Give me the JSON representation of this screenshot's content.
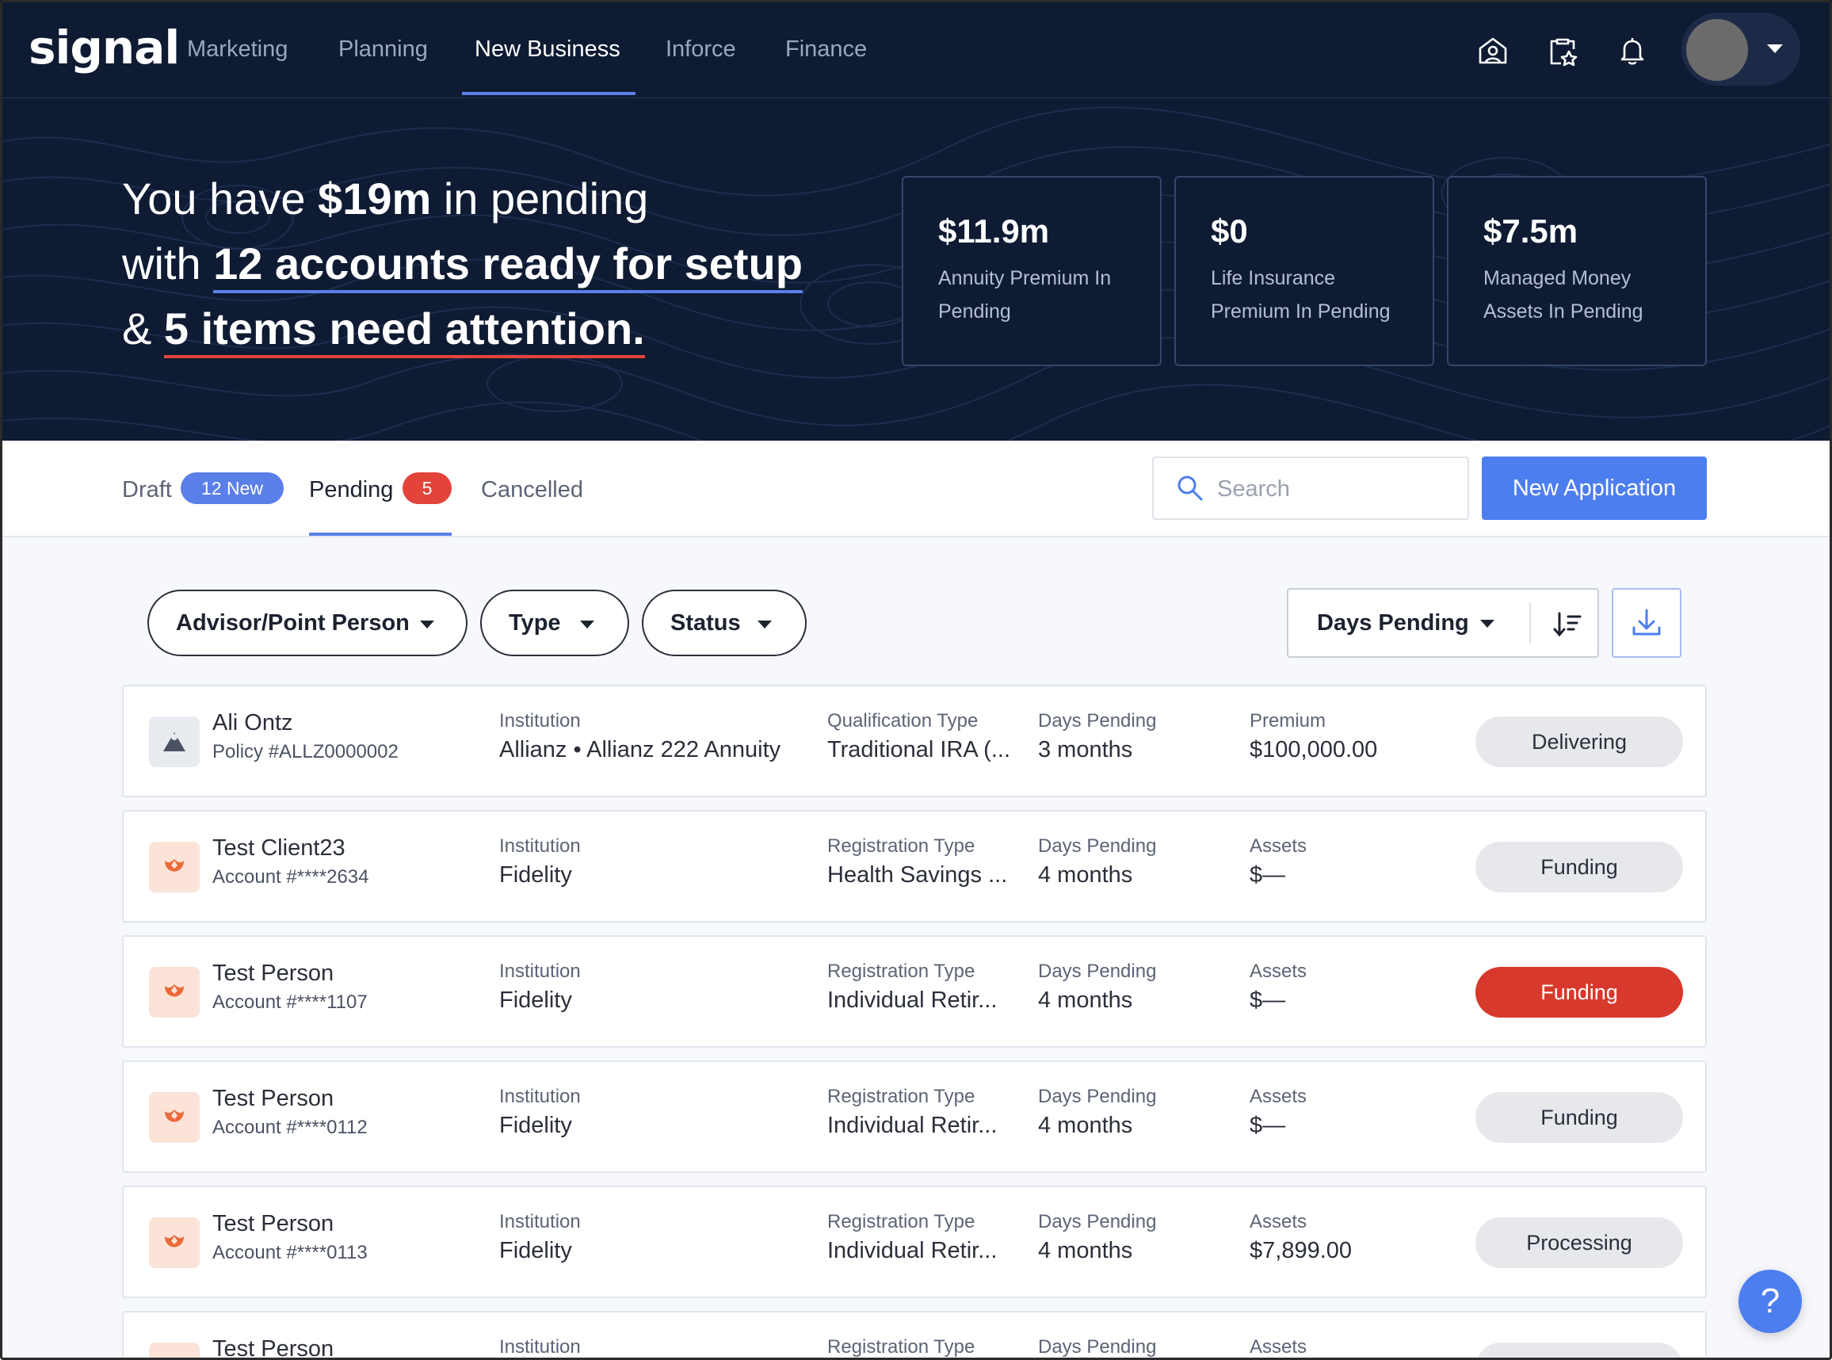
{
  "nav": {
    "logo": "signal",
    "items": [
      "Marketing",
      "Planning",
      "New Business",
      "Inforce",
      "Finance"
    ],
    "active_index": 2
  },
  "hero": {
    "line1_prefix": "You have ",
    "line1_amount": "$19m",
    "line1_suffix": " in pending",
    "line2_prefix": "with ",
    "line2_highlight": "12 accounts ready for setup",
    "line3_prefix": "& ",
    "line3_highlight": "5 items need attention."
  },
  "stats": [
    {
      "value": "$11.9m",
      "label": "Annuity Premium In Pending"
    },
    {
      "value": "$0",
      "label": "Life Insurance Premium In Pending"
    },
    {
      "value": "$7.5m",
      "label": "Managed Money Assets In Pending"
    }
  ],
  "tabs": {
    "draft": "Draft",
    "draft_badge": "12 New",
    "pending": "Pending",
    "pending_badge": "5",
    "cancelled": "Cancelled"
  },
  "search": {
    "placeholder": "Search"
  },
  "new_application_label": "New Application",
  "filters": {
    "advisor": "Advisor/Point Person",
    "type": "Type",
    "status": "Status",
    "sort_by": "Days Pending"
  },
  "rows": [
    {
      "icon": "person-icon",
      "name": "Ali Ontz",
      "id": "Policy #ALLZ0000002",
      "inst_label": "Institution",
      "inst": "Allianz • Allianz 222 Annuity",
      "type_label": "Qualification Type",
      "type": "Traditional IRA (...",
      "days_label": "Days Pending",
      "days": "3 months",
      "amt_label": "Premium",
      "amt": "$100,000.00",
      "status": "Delivering",
      "alert": false
    },
    {
      "icon": "fidelity-icon",
      "name": "Test Client23",
      "id": "Account #****2634",
      "inst_label": "Institution",
      "inst": "Fidelity",
      "type_label": "Registration Type",
      "type": "Health Savings ...",
      "days_label": "Days Pending",
      "days": "4 months",
      "amt_label": "Assets",
      "amt": "$—",
      "status": "Funding",
      "alert": false
    },
    {
      "icon": "fidelity-icon",
      "name": "Test Person",
      "id": "Account #****1107",
      "inst_label": "Institution",
      "inst": "Fidelity",
      "type_label": "Registration Type",
      "type": "Individual Retir...",
      "days_label": "Days Pending",
      "days": "4 months",
      "amt_label": "Assets",
      "amt": "$—",
      "status": "Funding",
      "alert": true
    },
    {
      "icon": "fidelity-icon",
      "name": "Test Person",
      "id": "Account #****0112",
      "inst_label": "Institution",
      "inst": "Fidelity",
      "type_label": "Registration Type",
      "type": "Individual Retir...",
      "days_label": "Days Pending",
      "days": "4 months",
      "amt_label": "Assets",
      "amt": "$—",
      "status": "Funding",
      "alert": false
    },
    {
      "icon": "fidelity-icon",
      "name": "Test Person",
      "id": "Account #****0113",
      "inst_label": "Institution",
      "inst": "Fidelity",
      "type_label": "Registration Type",
      "type": "Individual Retir...",
      "days_label": "Days Pending",
      "days": "4 months",
      "amt_label": "Assets",
      "amt": "$7,899.00",
      "status": "Processing",
      "alert": false
    },
    {
      "icon": "fidelity-icon",
      "name": "Test Person",
      "id": "",
      "inst_label": "Institution",
      "inst": "",
      "type_label": "Registration Type",
      "type": "",
      "days_label": "Days Pending",
      "days": "",
      "amt_label": "Assets",
      "amt": "",
      "status": "",
      "alert": false
    }
  ],
  "help_label": "?",
  "colors": {
    "navy": "#0e1b33",
    "accent": "#4d7ef0",
    "alert": "#d8392d",
    "fidelity": "#ea6a3a"
  }
}
